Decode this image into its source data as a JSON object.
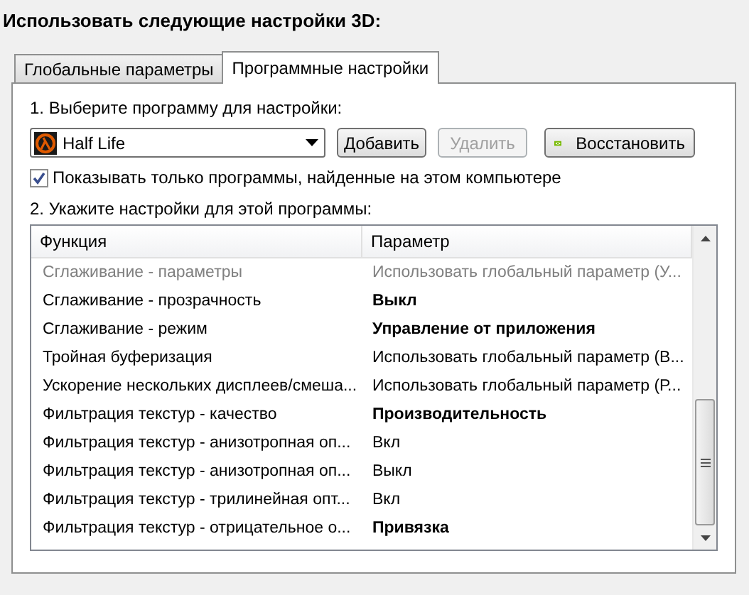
{
  "heading": "Использовать следующие настройки 3D:",
  "tabs": [
    {
      "label": "Глобальные параметры",
      "selected": false
    },
    {
      "label": "Программные настройки",
      "selected": true
    }
  ],
  "step1": "1. Выберите программу для настройки:",
  "program": {
    "value": "Half Life"
  },
  "buttons": [
    {
      "label": "Добавить",
      "disabled": false,
      "kind": "plain"
    },
    {
      "label": "Удалить",
      "disabled": true,
      "kind": "plain"
    },
    {
      "label": "Восстановить",
      "disabled": false,
      "kind": "logo"
    }
  ],
  "show_only_installed": {
    "label": "Показывать только программы, найденные на этом компьютере",
    "checked": true
  },
  "step2": "2. Укажите настройки для этой программы:",
  "table": {
    "columns": [
      "Функция",
      "Параметр"
    ],
    "rows": [
      {
        "function": "Сглаживание - параметры",
        "value": "Использовать глобальный параметр (У...",
        "modified": false,
        "disabled": true
      },
      {
        "function": "Сглаживание - прозрачность",
        "value": "Выкл",
        "modified": true,
        "disabled": false
      },
      {
        "function": "Сглаживание - режим",
        "value": "Управление от приложения",
        "modified": true,
        "disabled": false
      },
      {
        "function": "Тройная буферизация",
        "value": "Использовать глобальный параметр (В...",
        "modified": false,
        "disabled": false
      },
      {
        "function": "Ускорение нескольких дисплеев/смеша...",
        "value": "Использовать глобальный параметр (Р...",
        "modified": false,
        "disabled": false
      },
      {
        "function": "Фильтрация текстур - качество",
        "value": "Производительность",
        "modified": true,
        "disabled": false
      },
      {
        "function": "Фильтрация текстур - анизотропная оп...",
        "value": "Вкл",
        "modified": false,
        "disabled": false
      },
      {
        "function": "Фильтрация текстур - анизотропная оп...",
        "value": "Выкл",
        "modified": false,
        "disabled": false
      },
      {
        "function": "Фильтрация текстур - трилинейная опт...",
        "value": "Вкл",
        "modified": false,
        "disabled": false
      },
      {
        "function": "Фильтрация текстур - отрицательное о...",
        "value": "Привязка",
        "modified": true,
        "disabled": false
      }
    ]
  }
}
